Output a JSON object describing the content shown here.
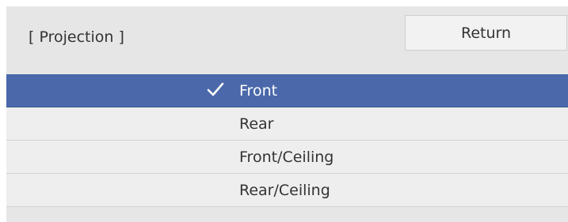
{
  "header": {
    "title": "[ Projection ]",
    "return_label": "Return"
  },
  "options": [
    {
      "label": "Front",
      "selected": true
    },
    {
      "label": "Rear",
      "selected": false
    },
    {
      "label": "Front/Ceiling",
      "selected": false
    },
    {
      "label": "Rear/Ceiling",
      "selected": false
    }
  ],
  "colors": {
    "selected_background": "#4a68aa",
    "panel_background": "#e6e6e6",
    "option_background": "#eeeeee",
    "text": "#333333"
  },
  "icons": {
    "selected_marker": "checkmark-icon"
  }
}
